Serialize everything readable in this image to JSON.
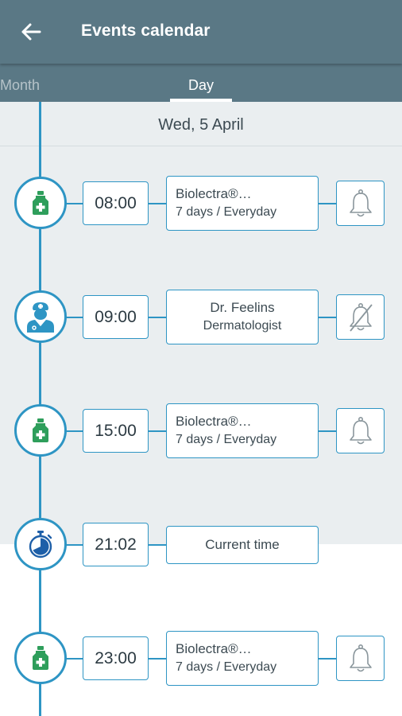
{
  "header": {
    "title": "Events calendar",
    "back_icon": "arrow-left-icon"
  },
  "tabs": [
    {
      "label": "Month",
      "active": false
    },
    {
      "label": "Day",
      "active": true
    }
  ],
  "date": "Wed, 5 April",
  "colors": {
    "header": "#5a7885",
    "accent": "#2e95c4",
    "icon_green": "#2e9e5b",
    "background_grey": "#eaeef0"
  },
  "events": [
    {
      "type": "medication",
      "icon": "medicine-bottle-icon",
      "time": "08:00",
      "line1": "Biolectra®…",
      "line2": "7 days / Everyday",
      "reminder": "bell-icon"
    },
    {
      "type": "doctor",
      "icon": "doctor-icon",
      "time": "09:00",
      "line1": "Dr. Feelins",
      "line2": "Dermatologist",
      "reminder": "bell-off-icon"
    },
    {
      "type": "medication",
      "icon": "medicine-bottle-icon",
      "time": "15:00",
      "line1": "Biolectra®…",
      "line2": "7 days / Everyday",
      "reminder": "bell-icon"
    },
    {
      "type": "current",
      "icon": "stopwatch-icon",
      "time": "21:02",
      "line1": "Current time"
    },
    {
      "type": "medication",
      "icon": "medicine-bottle-icon",
      "time": "23:00",
      "line1": "Biolectra®…",
      "line2": "7 days / Everyday",
      "reminder": "bell-icon"
    }
  ]
}
